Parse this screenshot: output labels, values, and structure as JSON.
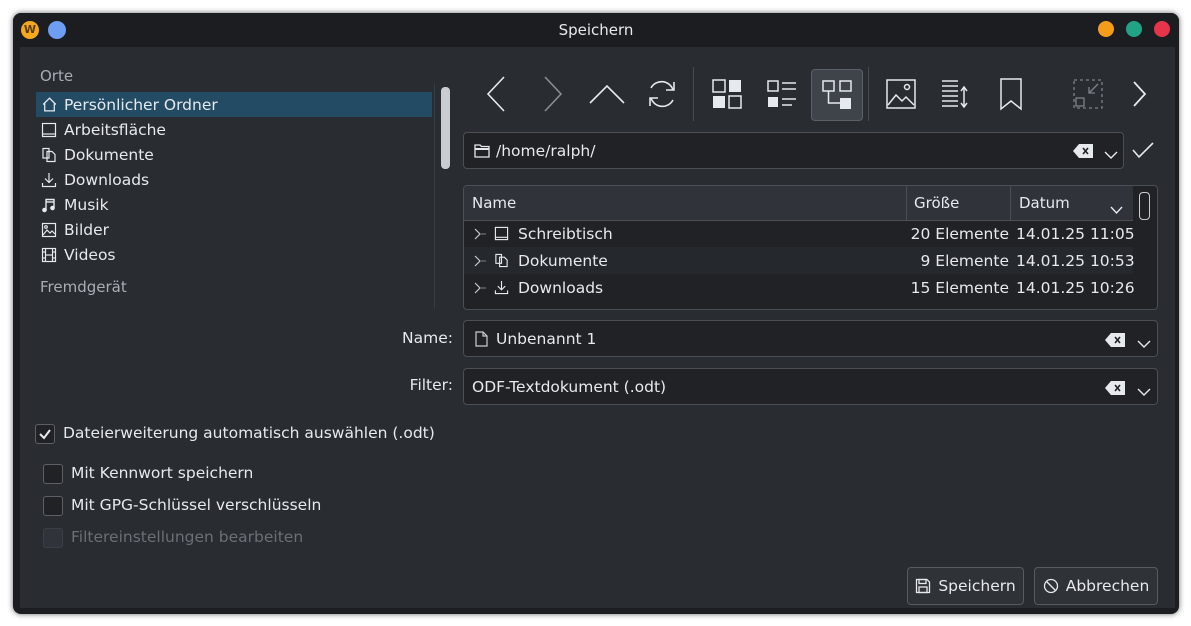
{
  "window": {
    "title": "Speichern",
    "app_icon_letter": "W",
    "controls": {
      "minimize": "#f59d1a",
      "maximize": "#22a386",
      "close": "#e8344a"
    }
  },
  "places": {
    "heading": "Orte",
    "items": [
      {
        "label": "Persönlicher Ordner",
        "icon": "home-icon",
        "selected": true
      },
      {
        "label": "Arbeitsfläche",
        "icon": "desktop-icon"
      },
      {
        "label": "Dokumente",
        "icon": "documents-icon"
      },
      {
        "label": "Downloads",
        "icon": "download-icon"
      },
      {
        "label": "Musik",
        "icon": "music-icon"
      },
      {
        "label": "Bilder",
        "icon": "image-icon"
      },
      {
        "label": "Videos",
        "icon": "video-icon"
      }
    ],
    "remote_heading": "Fremdgerät"
  },
  "toolbar": {
    "tools": [
      "back-icon",
      "forward-icon",
      "up-icon",
      "reload-icon",
      "icon-view-icon",
      "compact-view-icon",
      "tree-view-icon",
      "preview-icon",
      "sort-icon",
      "bookmark-icon",
      "collapse-icon",
      "more-icon"
    ],
    "active_tool": "tree-view-icon"
  },
  "location": {
    "path": "/home/ralph/"
  },
  "file_table": {
    "columns": [
      "Name",
      "Größe",
      "Datum"
    ],
    "rows": [
      {
        "name": "Schreibtisch",
        "icon": "desktop-icon",
        "size": "20 Elemente",
        "date": "14.01.25 11:05"
      },
      {
        "name": "Dokumente",
        "icon": "documents-icon",
        "size": "9 Elemente",
        "date": "14.01.25 10:53"
      },
      {
        "name": "Downloads",
        "icon": "download-icon",
        "size": "15 Elemente",
        "date": "14.01.25 10:26"
      }
    ]
  },
  "name_field": {
    "label": "Name:",
    "value": "Unbenannt 1"
  },
  "filter_field": {
    "label": "Filter:",
    "value": "ODF-Textdokument (.odt)"
  },
  "options": {
    "auto_extension": {
      "label": "Dateierweiterung automatisch auswählen (.odt)",
      "checked": true
    },
    "password": {
      "label": "Mit Kennwort speichern",
      "checked": false
    },
    "gpg": {
      "label": "Mit GPG-Schlüssel verschlüsseln",
      "checked": false
    },
    "filter_settings": {
      "label": "Filtereinstellungen bearbeiten",
      "checked": false,
      "disabled": true
    }
  },
  "buttons": {
    "save": "Speichern",
    "cancel": "Abbrechen"
  },
  "colors": {
    "accent": "#234b63",
    "background": "#292c31",
    "field": "#202226"
  }
}
